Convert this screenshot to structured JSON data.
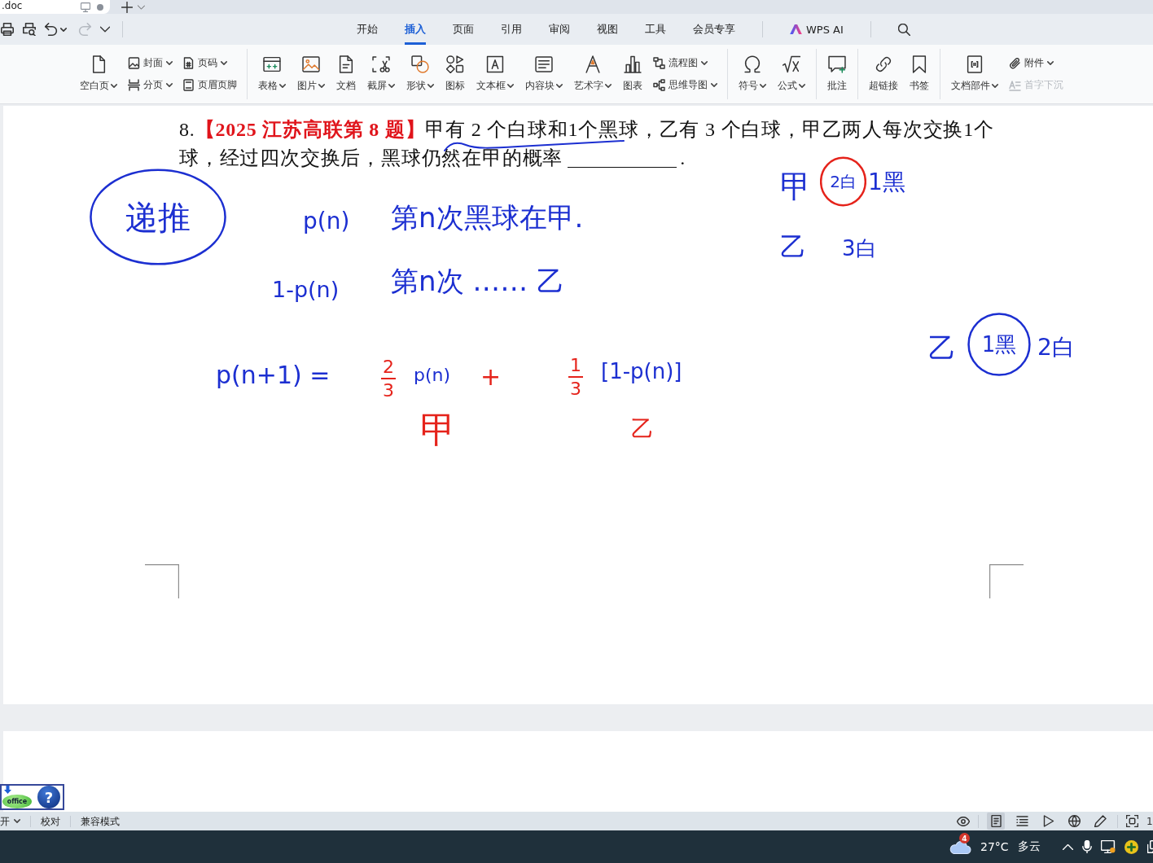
{
  "doc_tab": {
    "title": ".doc"
  },
  "quick_access": [
    {
      "disabled": false
    },
    {
      "disabled": false
    },
    {
      "disabled": false
    },
    {
      "disabled": true
    },
    {
      "disabled": false
    }
  ],
  "menu_tabs": [
    {
      "kind": "tab",
      "label": "开始",
      "selected": false
    },
    {
      "kind": "tab",
      "label": "插入",
      "selected": true
    },
    {
      "kind": "tab",
      "label": "页面",
      "selected": false
    },
    {
      "kind": "tab",
      "label": "引用",
      "selected": false
    },
    {
      "kind": "tab",
      "label": "审阅",
      "selected": false
    },
    {
      "kind": "tab",
      "label": "视图",
      "selected": false
    },
    {
      "kind": "tab",
      "label": "工具",
      "selected": false
    },
    {
      "kind": "tab",
      "label": "会员专享",
      "selected": false
    },
    {
      "kind": "ai",
      "label": "WPS AI",
      "selected": false
    }
  ],
  "ribbon": {
    "groups": [
      {
        "items": [
          {
            "kind": "large",
            "label": "空白页",
            "dropdown": true,
            "disabled": false
          },
          {
            "kind": "stack",
            "items": [
              {
                "label": "封面",
                "dropdown": true,
                "disabled": false
              },
              {
                "label": "分页",
                "dropdown": true,
                "disabled": false
              }
            ]
          },
          {
            "kind": "stack",
            "items": [
              {
                "label": "页码",
                "dropdown": true,
                "disabled": false
              },
              {
                "label": "页眉页脚",
                "dropdown": false,
                "disabled": false
              }
            ]
          }
        ]
      },
      {
        "items": [
          {
            "kind": "large",
            "label": "表格",
            "dropdown": true,
            "disabled": false
          },
          {
            "kind": "large",
            "label": "图片",
            "dropdown": true,
            "disabled": false
          },
          {
            "kind": "large",
            "label": "文档",
            "dropdown": false,
            "disabled": false
          },
          {
            "kind": "large",
            "label": "截屏",
            "dropdown": true,
            "disabled": false
          },
          {
            "kind": "large",
            "label": "形状",
            "dropdown": true,
            "disabled": false
          },
          {
            "kind": "large",
            "label": "图标",
            "dropdown": false,
            "disabled": false
          },
          {
            "kind": "large",
            "label": "文本框",
            "dropdown": true,
            "disabled": false
          },
          {
            "kind": "large",
            "label": "内容块",
            "dropdown": true,
            "disabled": false
          },
          {
            "kind": "large",
            "label": "艺术字",
            "dropdown": true,
            "disabled": false
          },
          {
            "kind": "large",
            "label": "图表",
            "dropdown": false,
            "disabled": false
          },
          {
            "kind": "stack",
            "items": [
              {
                "label": "流程图",
                "dropdown": true,
                "disabled": false
              },
              {
                "label": "思维导图",
                "dropdown": true,
                "disabled": false
              }
            ]
          }
        ]
      },
      {
        "items": [
          {
            "kind": "large",
            "label": "符号",
            "dropdown": true,
            "disabled": false
          },
          {
            "kind": "large",
            "label": "公式",
            "dropdown": true,
            "disabled": false
          }
        ]
      },
      {
        "items": [
          {
            "kind": "large",
            "label": "批注",
            "dropdown": false,
            "disabled": false
          }
        ]
      },
      {
        "items": [
          {
            "kind": "large",
            "label": "超链接",
            "dropdown": false,
            "disabled": false
          },
          {
            "kind": "large",
            "label": "书签",
            "dropdown": false,
            "disabled": false
          }
        ]
      },
      {
        "items": [
          {
            "kind": "large",
            "label": "文档部件",
            "dropdown": true,
            "disabled": false
          },
          {
            "kind": "stack",
            "items": [
              {
                "label": "附件",
                "dropdown": true,
                "disabled": false
              },
              {
                "label": "首字下沉",
                "dropdown": false,
                "disabled": true
              }
            ]
          }
        ]
      }
    ]
  },
  "question": {
    "lines": [
      "8.**【2025 江苏高联第 8 题】**甲有 2 个白球和1个黑球，乙有 3 个白球，甲乙两人每次交换1个",
      "球，经过四次交换后，黑球仍然在甲的概率"
    ],
    "ending": "."
  },
  "ink": [
    {
      "kind": "circled",
      "text": "递推",
      "color": "#1c2fd1",
      "ring": {
        "color": "#1c2fd1"
      }
    },
    {
      "kind": "text",
      "text": "p(n)",
      "color": "#1c2fd1"
    },
    {
      "kind": "text",
      "text": "第n次黑球在甲.",
      "color": "#1c2fd1"
    },
    {
      "kind": "text",
      "text": "1-p(n)",
      "color": "#1c2fd1"
    },
    {
      "kind": "text",
      "text": "第n次 …… 乙",
      "color": "#1c2fd1"
    },
    {
      "kind": "text",
      "text": "p(n+1) =",
      "color": "#1c2fd1"
    },
    {
      "kind": "fraction",
      "numerator": "2",
      "denominator": "3",
      "color": "#e5231b"
    },
    {
      "kind": "text",
      "text": "p(n)",
      "color": "#1c2fd1"
    },
    {
      "kind": "text",
      "text": "+",
      "color": "#e5231b"
    },
    {
      "kind": "fraction",
      "numerator": "1",
      "denominator": "3",
      "color": "#e5231b"
    },
    {
      "kind": "text",
      "text": "[1-p(n)]",
      "color": "#1c2fd1"
    },
    {
      "kind": "text",
      "text": "甲",
      "color": "#e5231b"
    },
    {
      "kind": "text",
      "text": "乙",
      "color": "#e5231b"
    },
    {
      "kind": "text",
      "text": "甲",
      "color": "#1c2fd1"
    },
    {
      "kind": "circled",
      "text": "2白",
      "color": "#1c2fd1",
      "ring": {
        "color": "#e5231b"
      }
    },
    {
      "kind": "text",
      "text": "1黑",
      "color": "#1c2fd1"
    },
    {
      "kind": "text",
      "text": "乙",
      "color": "#1c2fd1"
    },
    {
      "kind": "text",
      "text": "3白",
      "color": "#1c2fd1"
    },
    {
      "kind": "text",
      "text": "乙",
      "color": "#1c2fd1"
    },
    {
      "kind": "circled",
      "text": "1黑",
      "color": "#1c2fd1",
      "ring": {
        "color": "#1c2fd1"
      }
    },
    {
      "kind": "text",
      "text": "2白",
      "color": "#1c2fd1"
    },
    {
      "kind": "underline",
      "color": "#1c2fd1"
    }
  ],
  "float_widget": {
    "logo": "office",
    "help": "?"
  },
  "status_bar": {
    "left": [
      {
        "label": "开",
        "dropdown": true
      },
      {
        "label": "校对",
        "dropdown": false
      },
      {
        "label": "兼容模式",
        "dropdown": false
      }
    ],
    "view_modes": [
      {
        "selected": true
      },
      {
        "selected": false
      },
      {
        "selected": false
      },
      {
        "selected": false
      },
      {
        "selected": false
      }
    ],
    "zoom": "1"
  },
  "taskbar": {
    "weather_badge": "4",
    "temperature": "27°C",
    "condition": "多云"
  }
}
